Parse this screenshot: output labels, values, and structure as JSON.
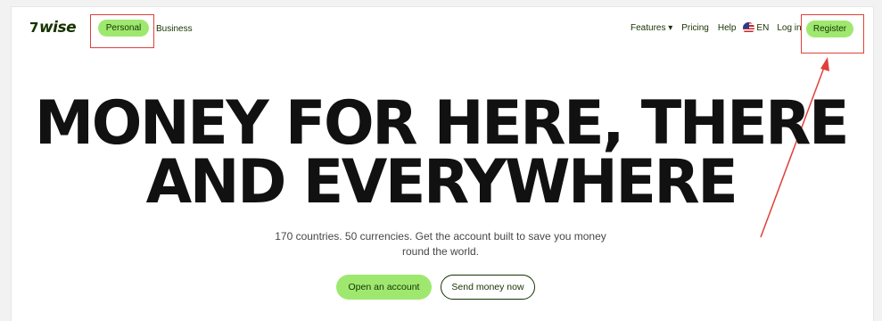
{
  "brand": {
    "logo_mark": "7",
    "logo_text": "wise"
  },
  "nav": {
    "personal_label": "Personal",
    "business_label": "Business",
    "features_label": "Features ▾",
    "pricing_label": "Pricing",
    "help_label": "Help",
    "language_label": "EN",
    "login_label": "Log in",
    "register_label": "Register"
  },
  "hero": {
    "headline_line1": "MONEY FOR HERE, THERE",
    "headline_line2": "AND EVERYWHERE",
    "subtext": "170 countries. 50 currencies. Get the account built to save you money round the world."
  },
  "actions": {
    "open_account_label": "Open an account",
    "send_money_label": "Send money now"
  },
  "colors": {
    "accent_green": "#9fe870",
    "brand_dark": "#163300",
    "annotation_red": "#e0403a"
  },
  "icons": {
    "language_flag": "us-flag-icon",
    "features_dropdown": "chevron-down-icon"
  }
}
